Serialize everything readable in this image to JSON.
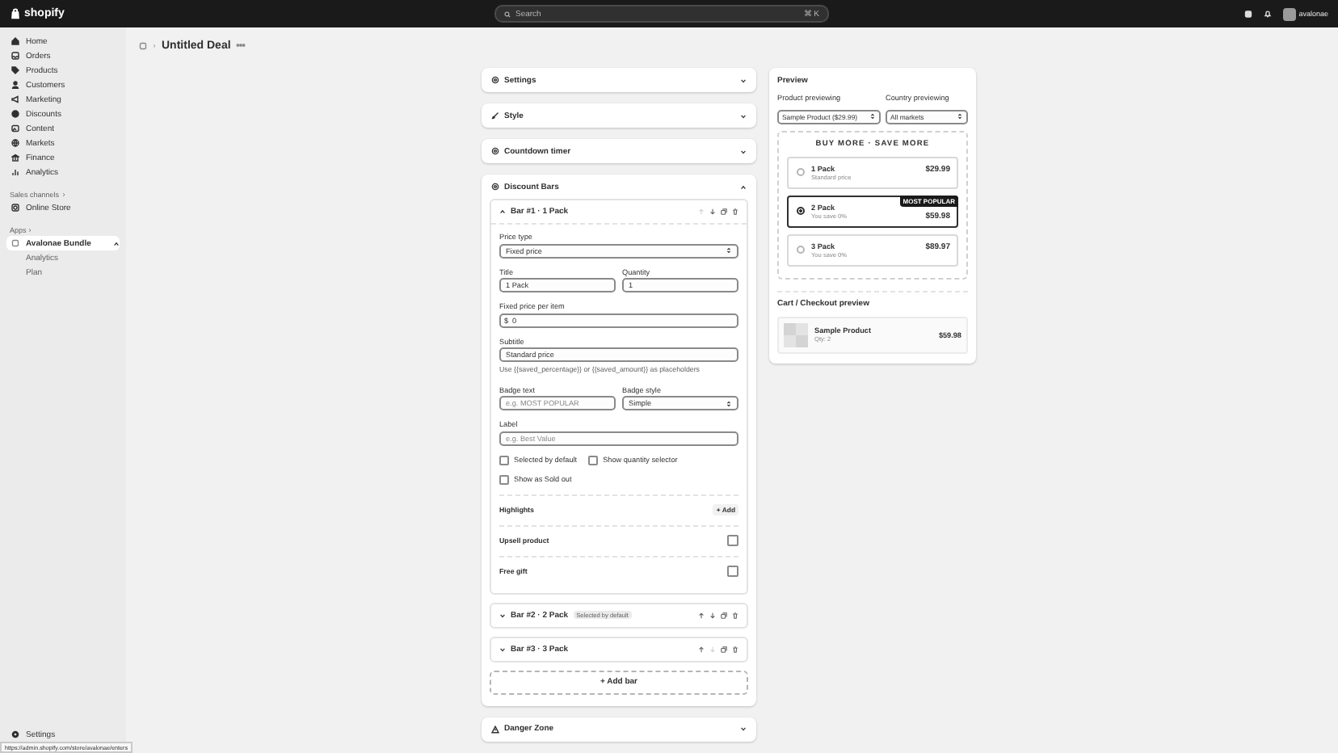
{
  "topbar": {
    "logo": "shopify",
    "search": {
      "placeholder": "Search",
      "shortcut": "⌘ K"
    },
    "store_name": "avalonae"
  },
  "sidebar": {
    "items": [
      {
        "label": "Home",
        "selected": false
      },
      {
        "label": "Orders",
        "selected": false
      },
      {
        "label": "Products",
        "selected": false
      },
      {
        "label": "Customers",
        "selected": false
      },
      {
        "label": "Marketing",
        "selected": false
      },
      {
        "label": "Discounts",
        "selected": false
      },
      {
        "label": "Content",
        "selected": false
      },
      {
        "label": "Markets",
        "selected": false
      },
      {
        "label": "Finance",
        "selected": false
      },
      {
        "label": "Analytics",
        "selected": false
      }
    ],
    "sales_channels": {
      "heading": "Sales channels",
      "items": [
        {
          "label": "Online Store"
        }
      ]
    },
    "apps": {
      "heading": "Apps",
      "items": [
        {
          "label": "Avalonae Bundle",
          "selected": true,
          "expanded": true,
          "children": [
            {
              "label": "Analytics"
            },
            {
              "label": "Plan"
            }
          ]
        }
      ]
    },
    "settings": "Settings"
  },
  "status_url": "https://admin.shopify.com/store/avalonae/enters",
  "page": {
    "title": "Untitled Deal"
  },
  "sections": [
    {
      "title": "Settings",
      "expanded": false
    },
    {
      "title": "Style",
      "expanded": false
    },
    {
      "title": "Countdown timer",
      "expanded": false
    },
    {
      "title": "Discount Bars",
      "expanded": true
    },
    {
      "title": "Danger Zone",
      "expanded": false
    }
  ],
  "bars": [
    {
      "title": "Bar #1 · 1 Pack",
      "expanded": true,
      "up_disabled": true,
      "down_disabled": false
    },
    {
      "title": "Bar #2 · 2 Pack",
      "badge": "Selected by default",
      "expanded": false,
      "up_disabled": false,
      "down_disabled": false
    },
    {
      "title": "Bar #3 · 3 Pack",
      "expanded": false,
      "up_disabled": false,
      "down_disabled": true
    }
  ],
  "bar_form": {
    "price_type": {
      "label": "Price type",
      "value": "Fixed price"
    },
    "title": {
      "label": "Title",
      "value": "1 Pack"
    },
    "quantity": {
      "label": "Quantity",
      "value": "1"
    },
    "fixed_price": {
      "label": "Fixed price per item",
      "prefix": "$",
      "value": "0"
    },
    "subtitle": {
      "label": "Subtitle",
      "value": "Standard price",
      "help": "Use {{saved_percentage}} or {{saved_amount}} as placeholders"
    },
    "badge_text": {
      "label": "Badge text",
      "placeholder": "e.g. MOST POPULAR"
    },
    "badge_style": {
      "label": "Badge style",
      "value": "Simple"
    },
    "label": {
      "label": "Label",
      "placeholder": "e.g. Best Value"
    },
    "checkboxes": [
      {
        "label": "Selected by default",
        "checked": false
      },
      {
        "label": "Show quantity selector",
        "checked": false
      },
      {
        "label": "Show as Sold out",
        "checked": false
      }
    ],
    "highlights": {
      "label": "Highlights",
      "button": "+ Add"
    },
    "toggles": [
      {
        "label": "Upsell product",
        "checked": false
      },
      {
        "label": "Free gift",
        "checked": false
      }
    ]
  },
  "add_bar": "+ Add bar",
  "preview": {
    "title": "Preview",
    "product": {
      "label": "Product previewing",
      "value": "Sample Product ($29.99)"
    },
    "country": {
      "label": "Country previewing",
      "value": "All markets"
    },
    "widget": {
      "heading": "BUY MORE · SAVE MORE",
      "options": [
        {
          "title": "1 Pack",
          "subtitle": "Standard price",
          "price": "$29.99",
          "selected": false
        },
        {
          "title": "2 Pack",
          "subtitle": "You save 0%",
          "price": "$59.98",
          "selected": true,
          "badge": "MOST POPULAR"
        },
        {
          "title": "3 Pack",
          "subtitle": "You save 0%",
          "price": "$89.97",
          "selected": false
        }
      ]
    },
    "cart": {
      "title": "Cart / Checkout preview",
      "item": {
        "name": "Sample Product",
        "qty": "Qty: 2",
        "price": "$59.98"
      }
    }
  }
}
